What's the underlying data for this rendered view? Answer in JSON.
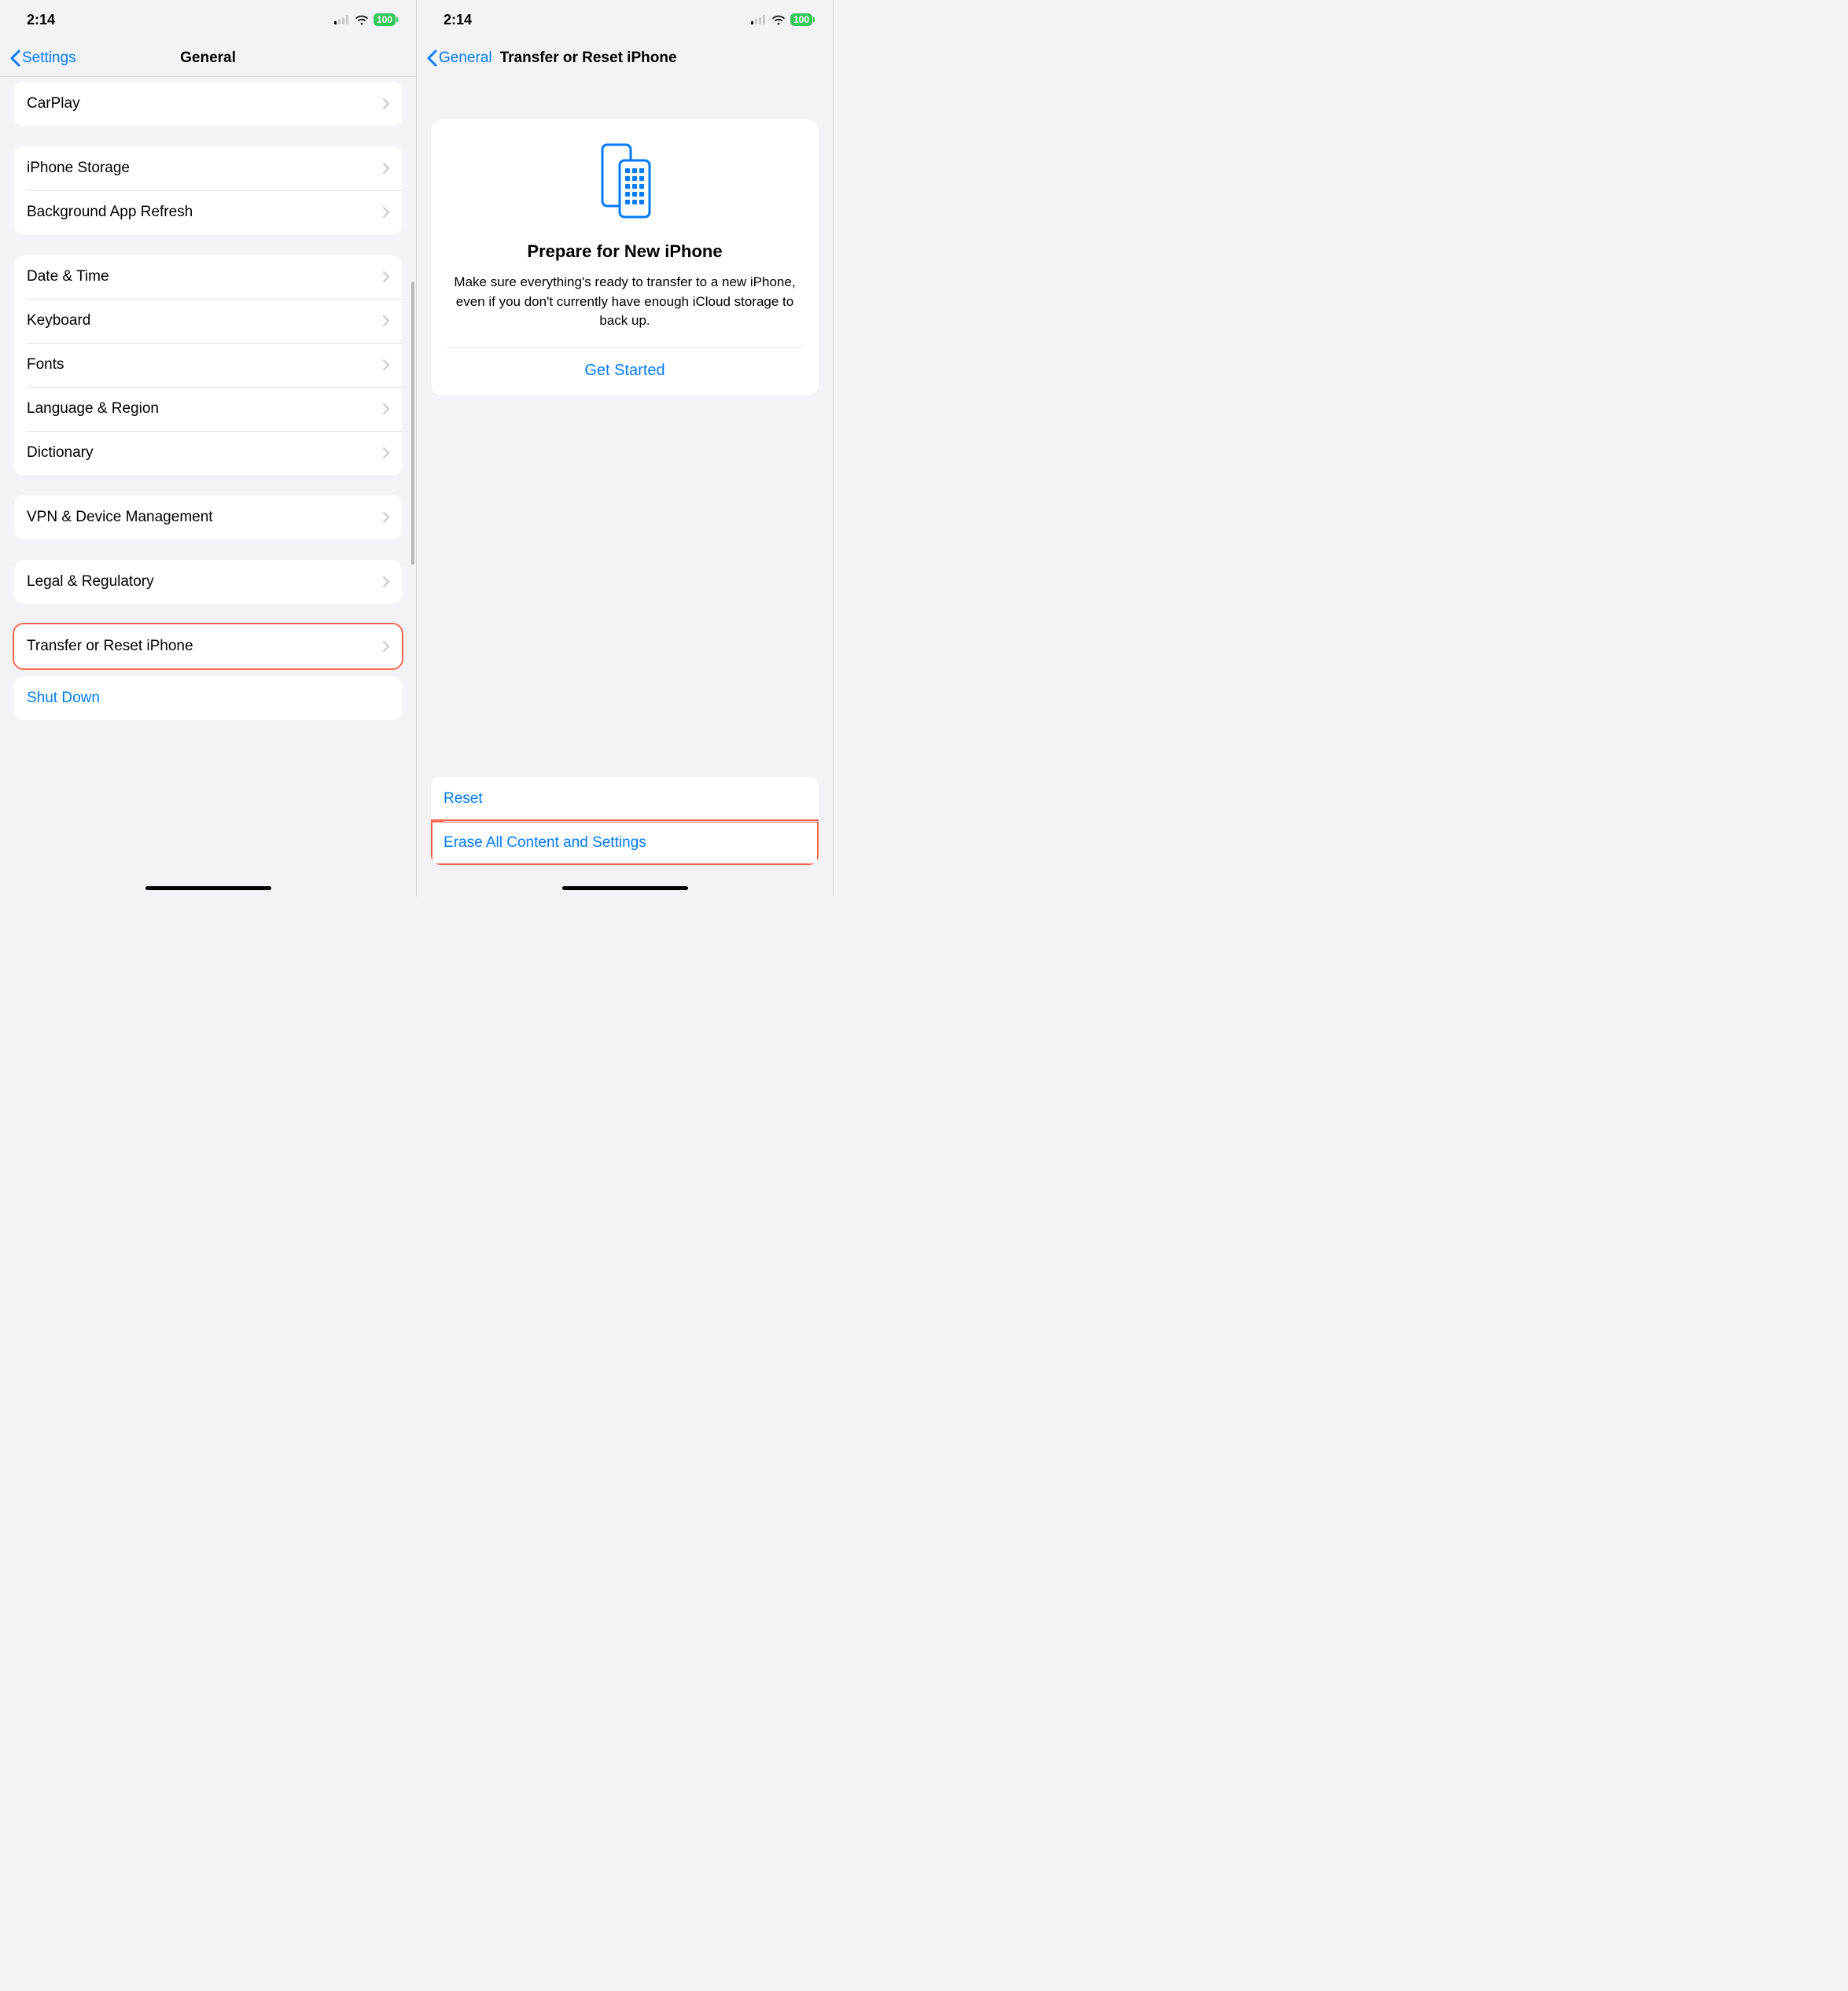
{
  "status": {
    "time": "2:14",
    "battery": "100"
  },
  "left": {
    "back_label": "Settings",
    "title": "General",
    "groups": {
      "g1": [
        {
          "label": "CarPlay"
        }
      ],
      "g2": [
        {
          "label": "iPhone Storage"
        },
        {
          "label": "Background App Refresh"
        }
      ],
      "g3": [
        {
          "label": "Date & Time"
        },
        {
          "label": "Keyboard"
        },
        {
          "label": "Fonts"
        },
        {
          "label": "Language & Region"
        },
        {
          "label": "Dictionary"
        }
      ],
      "g4": [
        {
          "label": "VPN & Device Management"
        }
      ],
      "g5": [
        {
          "label": "Legal & Regulatory"
        }
      ],
      "g6": [
        {
          "label": "Transfer or Reset iPhone"
        }
      ],
      "g7": [
        {
          "label": "Shut Down"
        }
      ]
    }
  },
  "right": {
    "back_label": "General",
    "title": "Transfer or Reset iPhone",
    "card": {
      "heading": "Prepare for New iPhone",
      "body": "Make sure everything's ready to transfer to a new iPhone, even if you don't currently have enough iCloud storage to back up.",
      "cta": "Get Started"
    },
    "bottom": {
      "reset": "Reset",
      "erase": "Erase All Content and Settings"
    }
  }
}
